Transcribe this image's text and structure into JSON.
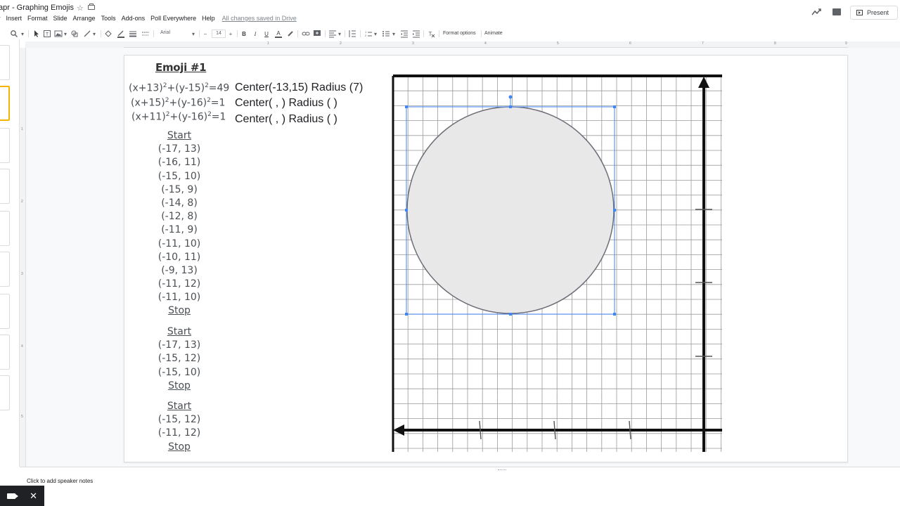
{
  "app": {
    "doc_title": "apr - Graphing Emojis",
    "star_glyph": "☆",
    "present_label": "Present"
  },
  "menu": {
    "items": [
      "v",
      "Insert",
      "Format",
      "Slide",
      "Arrange",
      "Tools",
      "Add-ons",
      "Poll Everywhere",
      "Help"
    ],
    "saved_status": "All changes saved in Drive"
  },
  "toolbar": {
    "font": "Arial",
    "font_size": "14",
    "format_options": "Format options",
    "animate": "Animate"
  },
  "ruler": {
    "top_ticks": [
      "1",
      "2",
      "3",
      "4",
      "5",
      "6",
      "7",
      "8",
      "9"
    ],
    "left_ticks": [
      "1",
      "2",
      "3",
      "4",
      "5"
    ]
  },
  "slide": {
    "title": "Emoji #1",
    "equations": [
      {
        "text": "(x+13)²+(y-15)²=49"
      },
      {
        "text": "(x+15)²+(y-16)²=1"
      },
      {
        "text": "(x+11)²+(y-16)²=1"
      }
    ],
    "center_lines": [
      "Center(-13,15) Radius (7)",
      "Center( , ) Radius ( )",
      "Center( , ) Radius ( )"
    ],
    "groups": [
      {
        "start": "Start",
        "points": [
          "(-17, 13)",
          "(-16, 11)",
          "(-15, 10)",
          "(-15, 9)",
          "(-14, 8)",
          "(-12, 8)",
          "(-11, 9)",
          "(-11, 10)",
          "(-10, 11)",
          "(-9, 13)",
          "(-11, 12)",
          "(-11, 10)"
        ],
        "stop": "Stop"
      },
      {
        "start": "Start",
        "points": [
          "(-17, 13)",
          "(-15, 12)",
          "(-15, 10)"
        ],
        "stop": "Stop"
      },
      {
        "start": "Start",
        "points": [
          "(-15, 12)",
          "(-11, 12)"
        ],
        "stop": "Stop"
      }
    ]
  },
  "notes": {
    "placeholder": "Click to add speaker notes"
  },
  "colors": {
    "selection": "#4285f4",
    "circle_fill": "#e8e8e8",
    "active_thumb": "#f4b400"
  }
}
